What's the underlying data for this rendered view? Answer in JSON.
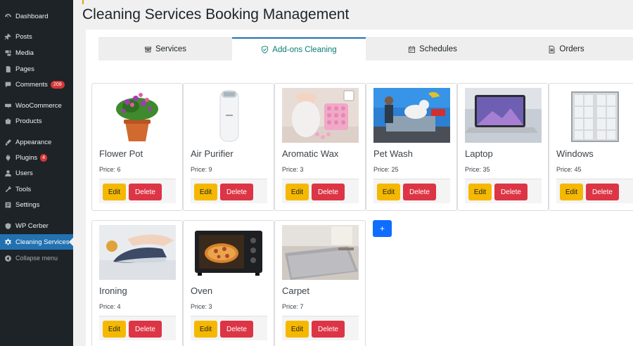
{
  "sidebar": {
    "items": [
      {
        "label": "Dashboard",
        "icon": "dashboard-icon"
      },
      {
        "label": "Posts",
        "icon": "pin-icon"
      },
      {
        "label": "Media",
        "icon": "media-icon"
      },
      {
        "label": "Pages",
        "icon": "pages-icon"
      },
      {
        "label": "Comments",
        "icon": "comments-icon",
        "badge": "209"
      },
      {
        "label": "WooCommerce",
        "icon": "woocommerce-icon"
      },
      {
        "label": "Products",
        "icon": "products-icon"
      },
      {
        "label": "Appearance",
        "icon": "appearance-icon"
      },
      {
        "label": "Plugins",
        "icon": "plugins-icon",
        "badge": "4"
      },
      {
        "label": "Users",
        "icon": "users-icon"
      },
      {
        "label": "Tools",
        "icon": "tools-icon"
      },
      {
        "label": "Settings",
        "icon": "settings-icon"
      },
      {
        "label": "WP Cerber",
        "icon": "cerber-icon"
      },
      {
        "label": "Cleaning Services",
        "icon": "gear-icon",
        "active": true
      },
      {
        "label": "Collapse menu",
        "icon": "collapse-icon"
      }
    ]
  },
  "page": {
    "title": "Cleaning Services Booking Management"
  },
  "tabs": [
    {
      "label": "Services",
      "icon": "archive-icon"
    },
    {
      "label": "Add-ons Cleaning",
      "icon": "shield-check-icon",
      "active": true
    },
    {
      "label": "Schedules",
      "icon": "calendar-icon"
    },
    {
      "label": "Orders",
      "icon": "document-icon"
    }
  ],
  "cards": [
    {
      "name": "Flower Pot",
      "price": "Price: 6",
      "image": "flower-pot-image"
    },
    {
      "name": "Air Purifier",
      "price": "Price: 9",
      "image": "air-purifier-image"
    },
    {
      "name": "Aromatic Wax",
      "price": "Price: 3",
      "image": "aromatic-wax-image"
    },
    {
      "name": "Pet Wash",
      "price": "Price: 25",
      "image": "pet-wash-image"
    },
    {
      "name": "Laptop",
      "price": "Price: 35",
      "image": "laptop-image"
    },
    {
      "name": "Windows",
      "price": "Price: 45",
      "image": "windows-image"
    },
    {
      "name": "Ironing",
      "price": "Price: 4",
      "image": "ironing-image"
    },
    {
      "name": "Oven",
      "price": "Price: 3",
      "image": "oven-image"
    },
    {
      "name": "Carpet",
      "price": "Price: 7",
      "image": "carpet-image"
    }
  ],
  "actions": {
    "edit_label": "Edit",
    "delete_label": "Delete",
    "add_label": "+"
  },
  "colors": {
    "sidebar_bg": "#1d2327",
    "active_menu": "#2271b1",
    "edit_button": "#f5b800",
    "delete_button": "#dc3545",
    "add_button": "#0d6efd",
    "active_tab_text": "#087d73"
  }
}
